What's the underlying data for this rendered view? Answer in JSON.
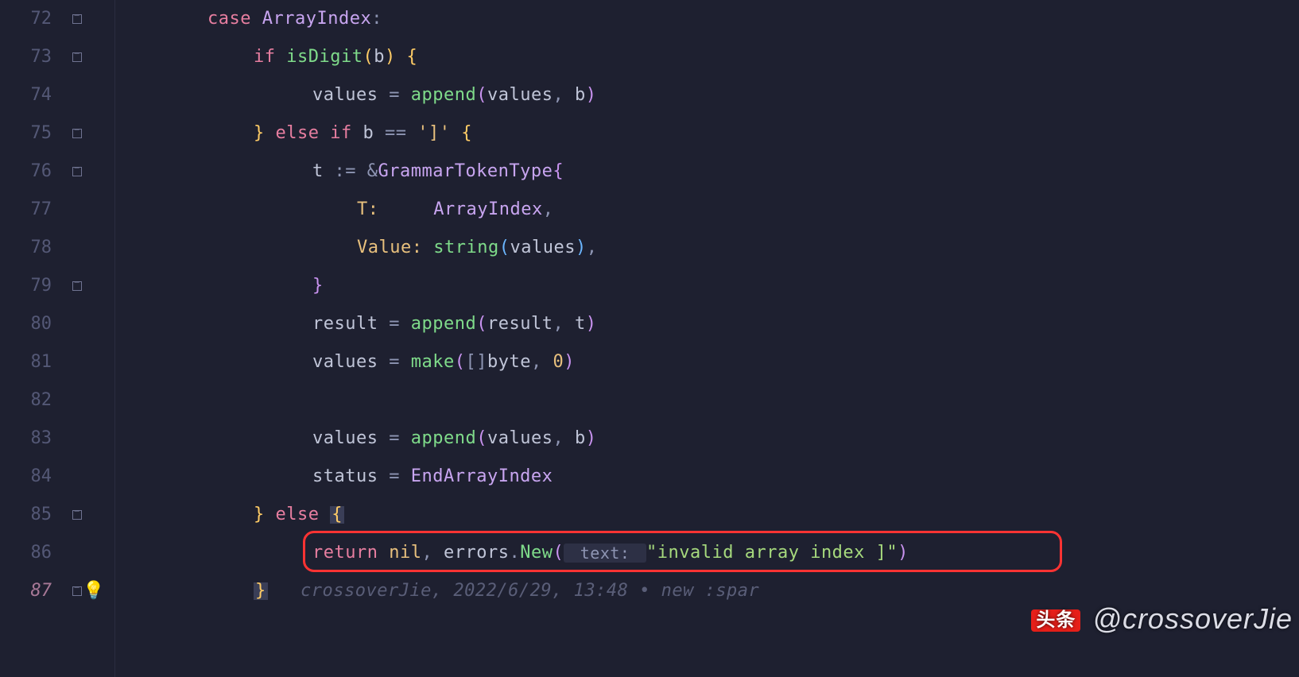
{
  "gutter": {
    "start": 72,
    "lines": [
      "72",
      "73",
      "74",
      "75",
      "76",
      "77",
      "78",
      "79",
      "80",
      "81",
      "82",
      "83",
      "84",
      "85",
      "86",
      "87"
    ],
    "modified_index": 15
  },
  "code": {
    "l72": {
      "kw": "case",
      "type": "ArrayIndex",
      "colon": ":"
    },
    "l73": {
      "kw": "if",
      "fn": "isDigit",
      "lp": "(",
      "arg": "b",
      "rp": ")",
      "lbrace": " {"
    },
    "l74": {
      "lhs": "values",
      "op": " = ",
      "fn": "append",
      "lp": "(",
      "a1": "values",
      "c": ", ",
      "a2": "b",
      "rp": ")"
    },
    "l75": {
      "rbrace": "}",
      "kw1": " else if ",
      "lhs": "b",
      "op": " == ",
      "rune": "']'",
      "lbrace": " {"
    },
    "l76": {
      "lhs": "t",
      "op": " := ",
      "amp": "&",
      "type": "GrammarTokenType",
      "lbrace": "{"
    },
    "l77": {
      "key": "T:",
      "pad": "     ",
      "val": "ArrayIndex",
      "c": ","
    },
    "l78": {
      "key": "Value:",
      "sp": " ",
      "fn": "string",
      "lp": "(",
      "arg": "values",
      "rp": ")",
      "c": ","
    },
    "l79": {
      "rbrace": "}"
    },
    "l80": {
      "lhs": "result",
      "op": " = ",
      "fn": "append",
      "lp": "(",
      "a1": "result",
      "c": ", ",
      "a2": "t",
      "rp": ")"
    },
    "l81": {
      "lhs": "values",
      "op": " = ",
      "fn": "make",
      "lp": "(",
      "lb": "[]",
      "typ": "byte",
      "c": ", ",
      "num": "0",
      "rp": ")"
    },
    "l82": {},
    "l83": {
      "lhs": "values",
      "op": " = ",
      "fn": "append",
      "lp": "(",
      "a1": "values",
      "c": ", ",
      "a2": "b",
      "rp": ")"
    },
    "l84": {
      "lhs": "status",
      "op": " = ",
      "val": "EndArrayIndex"
    },
    "l85": {
      "rbrace": "}",
      "kw": " else ",
      "lbrace": "{"
    },
    "l86": {
      "kw": "return",
      "sp": " ",
      "nil": "nil",
      "c1": ", ",
      "pkg": "errors",
      "dot": ".",
      "fn": "New",
      "lp": "(",
      "hl": " text: ",
      "str": "\"invalid array index ]\"",
      "rp": ")"
    },
    "l87": {
      "rbrace": "}",
      "ann": "   crossoverJie, 2022/6/29, 13:48 • new :spar"
    }
  },
  "watermark": {
    "logo": "头条",
    "text": " @crossoverJie"
  }
}
